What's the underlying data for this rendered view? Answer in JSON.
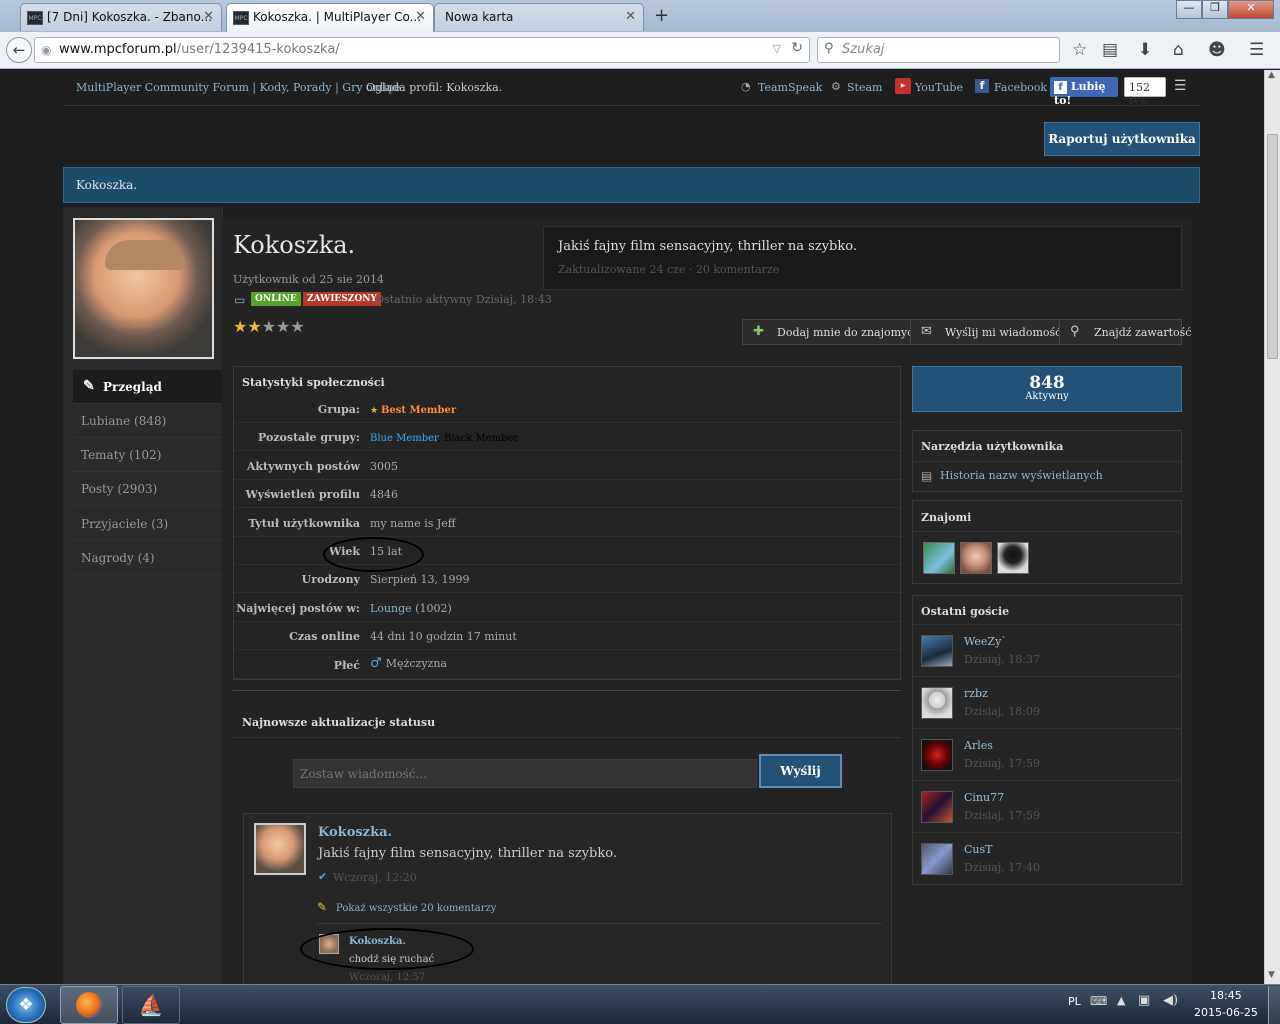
{
  "browser": {
    "tabs": [
      {
        "title": "[7 Dni] Kokoszka. - Zbano...",
        "active": false
      },
      {
        "title": "Kokoszka. | MultiPlayer Co...",
        "active": true
      },
      {
        "title": "Nowa karta",
        "active": false
      }
    ],
    "new_tab": "+",
    "url_domain": "www.mpcforum.pl",
    "url_path": "/user/1239415-kokoszka/",
    "search_placeholder": "Szukaj",
    "window_buttons": [
      "—",
      "❐",
      "✕"
    ]
  },
  "header": {
    "breadcrumb": "MultiPlayer Community Forum | Kody, Porady | Gry online",
    "viewing": "Ogląda profil: Kokoszka.",
    "links": [
      "TeamSpeak",
      "Steam",
      "YouTube",
      "Facebook"
    ],
    "like_label": "Lubię to!",
    "like_count": "152 tys."
  },
  "report_button": "Raportuj użytkownika",
  "banner_title": "Kokoszka.",
  "profile": {
    "name": "Kokoszka.",
    "member_since": "Użytkownik od 25 sie 2014",
    "online_badge": "ONLINE",
    "suspended_badge": "ZAWIESZONY",
    "last_active": "Ostatnio aktywny Dzisiaj, 18:43",
    "rating": 2,
    "status_text": "Jakiś fajny film sensacyjny, thriller na szybko.",
    "status_meta": "Zaktualizowane 24 cze · 20 komentarze"
  },
  "actions": [
    "Dodaj mnie do znajomych",
    "Wyślij mi wiadomość",
    "Znajdź zawartość"
  ],
  "sidebar": [
    {
      "label": "Przegląd",
      "active": true
    },
    {
      "label": "Lubiane (848)"
    },
    {
      "label": "Tematy (102)"
    },
    {
      "label": "Posty (2903)"
    },
    {
      "label": "Przyjaciele (3)"
    },
    {
      "label": "Nagrody (4)"
    }
  ],
  "stats_title": "Statystyki społeczności",
  "stats": [
    {
      "k": "Grupa:",
      "v": "Best Member"
    },
    {
      "k": "Pozostałe grupy:",
      "v": "Blue Member",
      "v2": ", Black Member"
    },
    {
      "k": "Aktywnych postów",
      "v": "3005"
    },
    {
      "k": "Wyświetleń profilu",
      "v": "4846"
    },
    {
      "k": "Tytuł użytkownika",
      "v": "my name is Jeff"
    },
    {
      "k": "Wiek",
      "v": "15 lat"
    },
    {
      "k": "Urodzony",
      "v": "Sierpień 13, 1999"
    },
    {
      "k": "Najwięcej postów w:",
      "v": "Lounge",
      "v2": " (1002)"
    },
    {
      "k": "Czas online",
      "v": "44 dni 10 godzin 17 minut"
    },
    {
      "k": "Płeć",
      "v": "Mężczyzna"
    }
  ],
  "reputation": {
    "value": "848",
    "label": "Aktywny"
  },
  "tools": {
    "title": "Narzędzia użytkownika",
    "item": "Historia nazw wyświetlanych"
  },
  "friends_title": "Znajomi",
  "visitors_title": "Ostatni goście",
  "visitors": [
    {
      "name": "WeeZy`",
      "time": "Dzisiaj, 18:37"
    },
    {
      "name": "rzbz",
      "time": "Dzisiaj, 18:09"
    },
    {
      "name": "Arles",
      "time": "Dzisiaj, 17:59"
    },
    {
      "name": "Cinu77",
      "time": "Dzisiaj, 17:59"
    },
    {
      "name": "CusT",
      "time": "Dzisiaj, 17:40"
    }
  ],
  "status_updates": {
    "title": "Najnowsze aktualizacje statusu",
    "placeholder": "Zostaw wiadomość...",
    "send": "Wyślij",
    "post_author": "Kokoszka.",
    "post_text": "Jakiś fajny film sensacyjny, thriller na szybko.",
    "post_time": "Wczoraj, 12:20",
    "show_comments": "Pokaż wszystkie 20 komentarzy",
    "comment_author": "Kokoszka.",
    "comment_text": "chodź się ruchać",
    "comment_time": "Wczoraj, 12:57"
  },
  "taskbar": {
    "lang": "PL",
    "time": "18:45",
    "date": "2015-06-25"
  }
}
